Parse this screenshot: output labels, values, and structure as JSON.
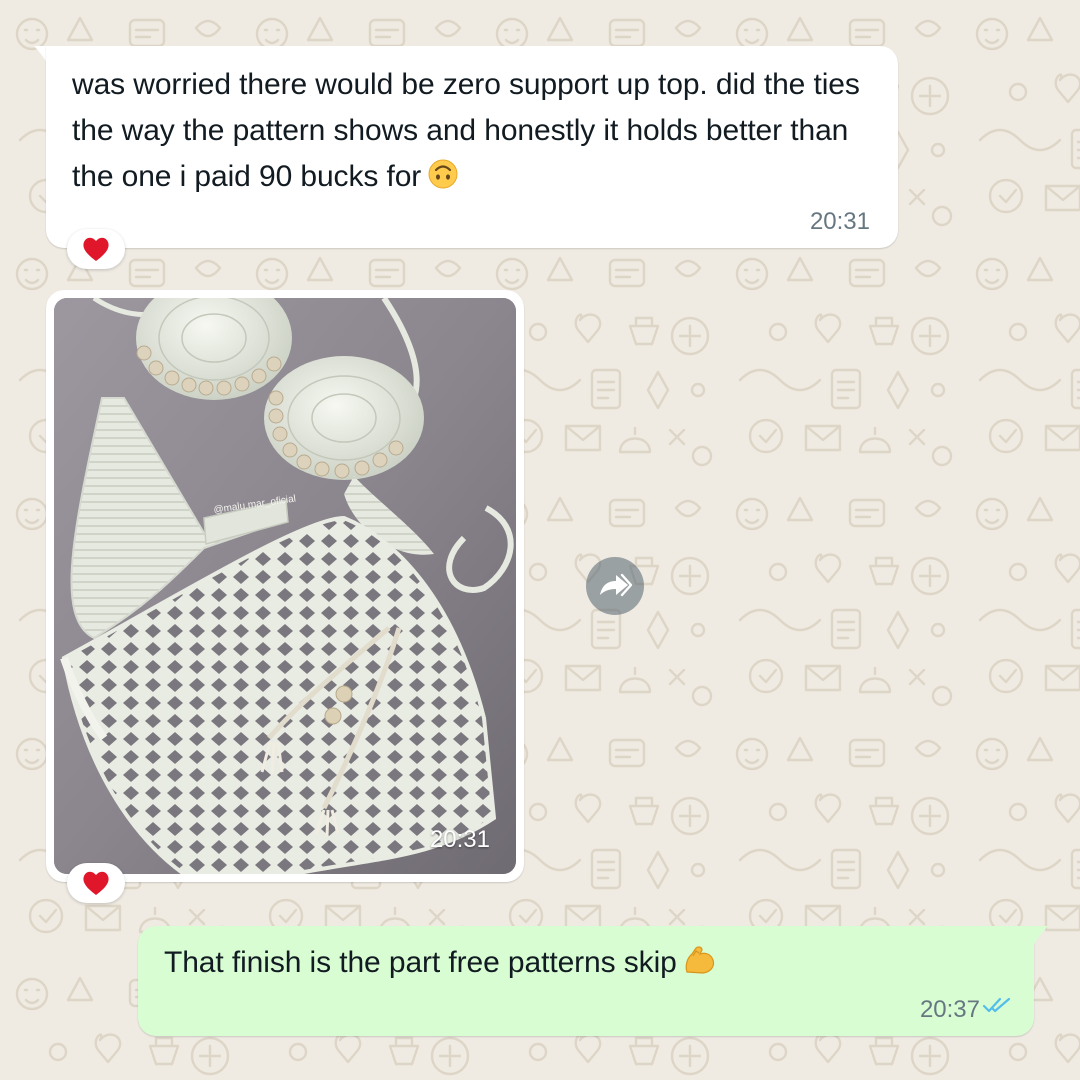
{
  "messages": [
    {
      "direction": "incoming",
      "type": "text",
      "text": "was worried there would be zero support up top. did the ties the way the pattern shows and honestly it holds better than the one i paid 90 bucks for",
      "emoji": "upside-down-face",
      "time": "20:31",
      "reaction": "red-heart"
    },
    {
      "direction": "incoming",
      "type": "image",
      "image_description": "White crochet bikini top with wooden beads, a second crochet top, and a lacy crochet skirt on a grey surface",
      "watermark": "@malu.mar_oficial",
      "time": "20:31",
      "reaction": "red-heart",
      "action": "forward-icon"
    },
    {
      "direction": "outgoing",
      "type": "text",
      "text": "That finish is the part free patterns skip",
      "emoji": "flexed-biceps",
      "time": "20:37",
      "status": "read"
    }
  ],
  "colors": {
    "chat_background": "#efeae2",
    "incoming_bubble": "#ffffff",
    "outgoing_bubble": "#d9fdd3",
    "text": "#111b21",
    "timestamp": "#667781",
    "read_ticks": "#53bdeb"
  }
}
